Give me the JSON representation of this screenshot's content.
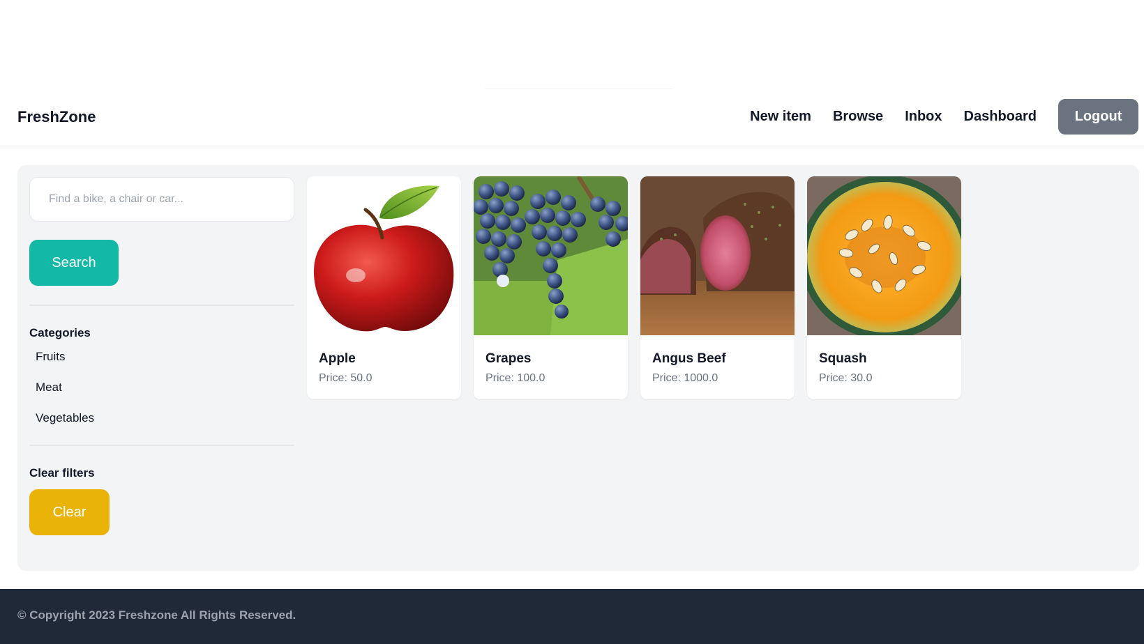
{
  "header": {
    "brand": "FreshZone",
    "nav": [
      {
        "label": "New item"
      },
      {
        "label": "Browse"
      },
      {
        "label": "Inbox"
      },
      {
        "label": "Dashboard"
      }
    ],
    "logout_label": "Logout",
    "logout_color": "#6b7280"
  },
  "sidebar": {
    "search_placeholder": "Find a bike, a chair or car...",
    "search_value": "",
    "search_button": "Search",
    "search_button_color": "#14b8a6",
    "categories_title": "Categories",
    "categories": [
      "Fruits",
      "Meat",
      "Vegetables"
    ],
    "clear_title": "Clear filters",
    "clear_button": "Clear",
    "clear_button_color": "#eab308"
  },
  "items": [
    {
      "name": "Apple",
      "price_label": "Price: 50.0",
      "image": "apple"
    },
    {
      "name": "Grapes",
      "price_label": "Price: 100.0",
      "image": "grapes"
    },
    {
      "name": "Angus Beef",
      "price_label": "Price: 1000.0",
      "image": "beef"
    },
    {
      "name": "Squash",
      "price_label": "Price: 30.0",
      "image": "squash"
    }
  ],
  "footer": {
    "text": "© Copyright 2023 Freshzone All Rights Reserved.",
    "background": "#1f2937"
  }
}
